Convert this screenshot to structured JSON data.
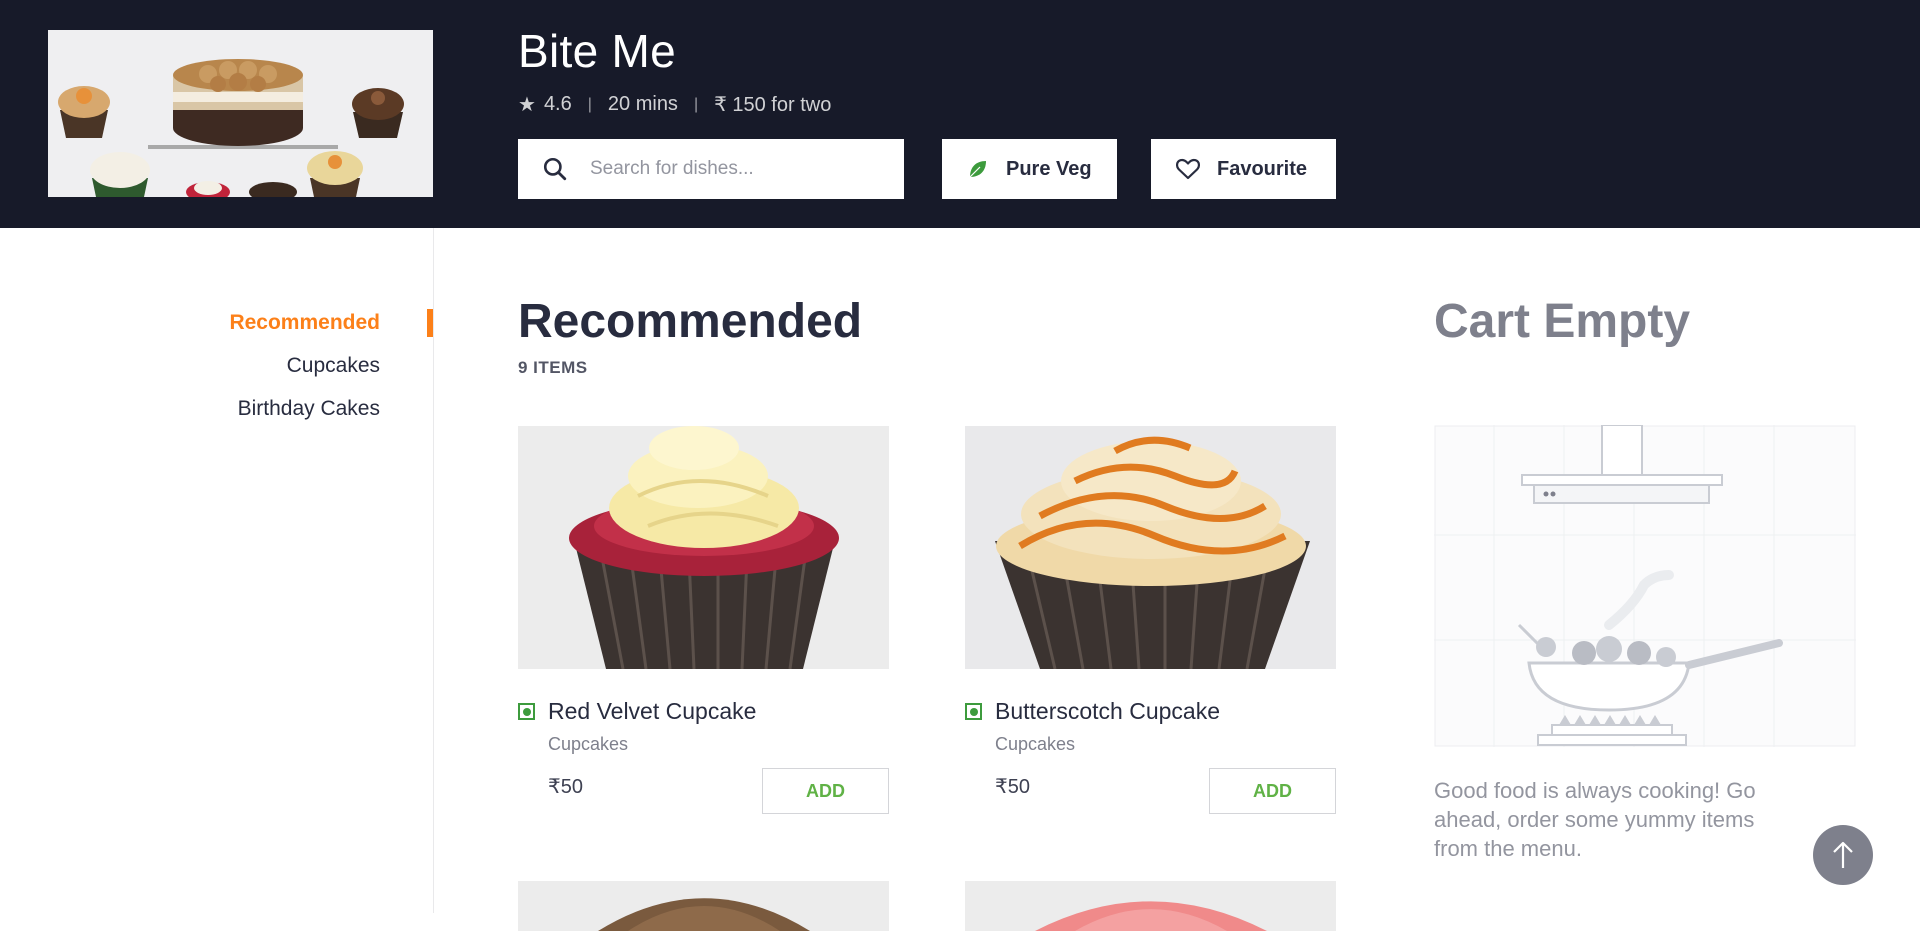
{
  "restaurant": {
    "name": "Bite Me",
    "rating": "4.6",
    "delivery_time": "20 mins",
    "cost_for_two": "₹ 150 for two"
  },
  "search": {
    "placeholder": "Search for dishes..."
  },
  "filters": {
    "pure_veg_label": "Pure Veg",
    "favourite_label": "Favourite"
  },
  "sidebar": {
    "items": [
      {
        "label": "Recommended",
        "active": true
      },
      {
        "label": "Cupcakes",
        "active": false
      },
      {
        "label": "Birthday Cakes",
        "active": false
      }
    ]
  },
  "section": {
    "title": "Recommended",
    "count": "9 ITEMS"
  },
  "items": [
    {
      "name": "Red Velvet Cupcake",
      "category": "Cupcakes",
      "price": "₹50",
      "add_label": "ADD",
      "veg": true
    },
    {
      "name": "Butterscotch Cupcake",
      "category": "Cupcakes",
      "price": "₹50",
      "add_label": "ADD",
      "veg": true
    }
  ],
  "cart": {
    "title": "Cart Empty",
    "message": "Good food is always cooking! Go ahead, order some yummy items from the menu."
  },
  "colors": {
    "accent": "#fc8019",
    "header_bg": "#171a29",
    "veg_green": "#3d9b3d",
    "add_green": "#60b246"
  },
  "icons": [
    "search-icon",
    "leaf-icon",
    "heart-icon",
    "star-icon",
    "arrow-up-icon"
  ]
}
